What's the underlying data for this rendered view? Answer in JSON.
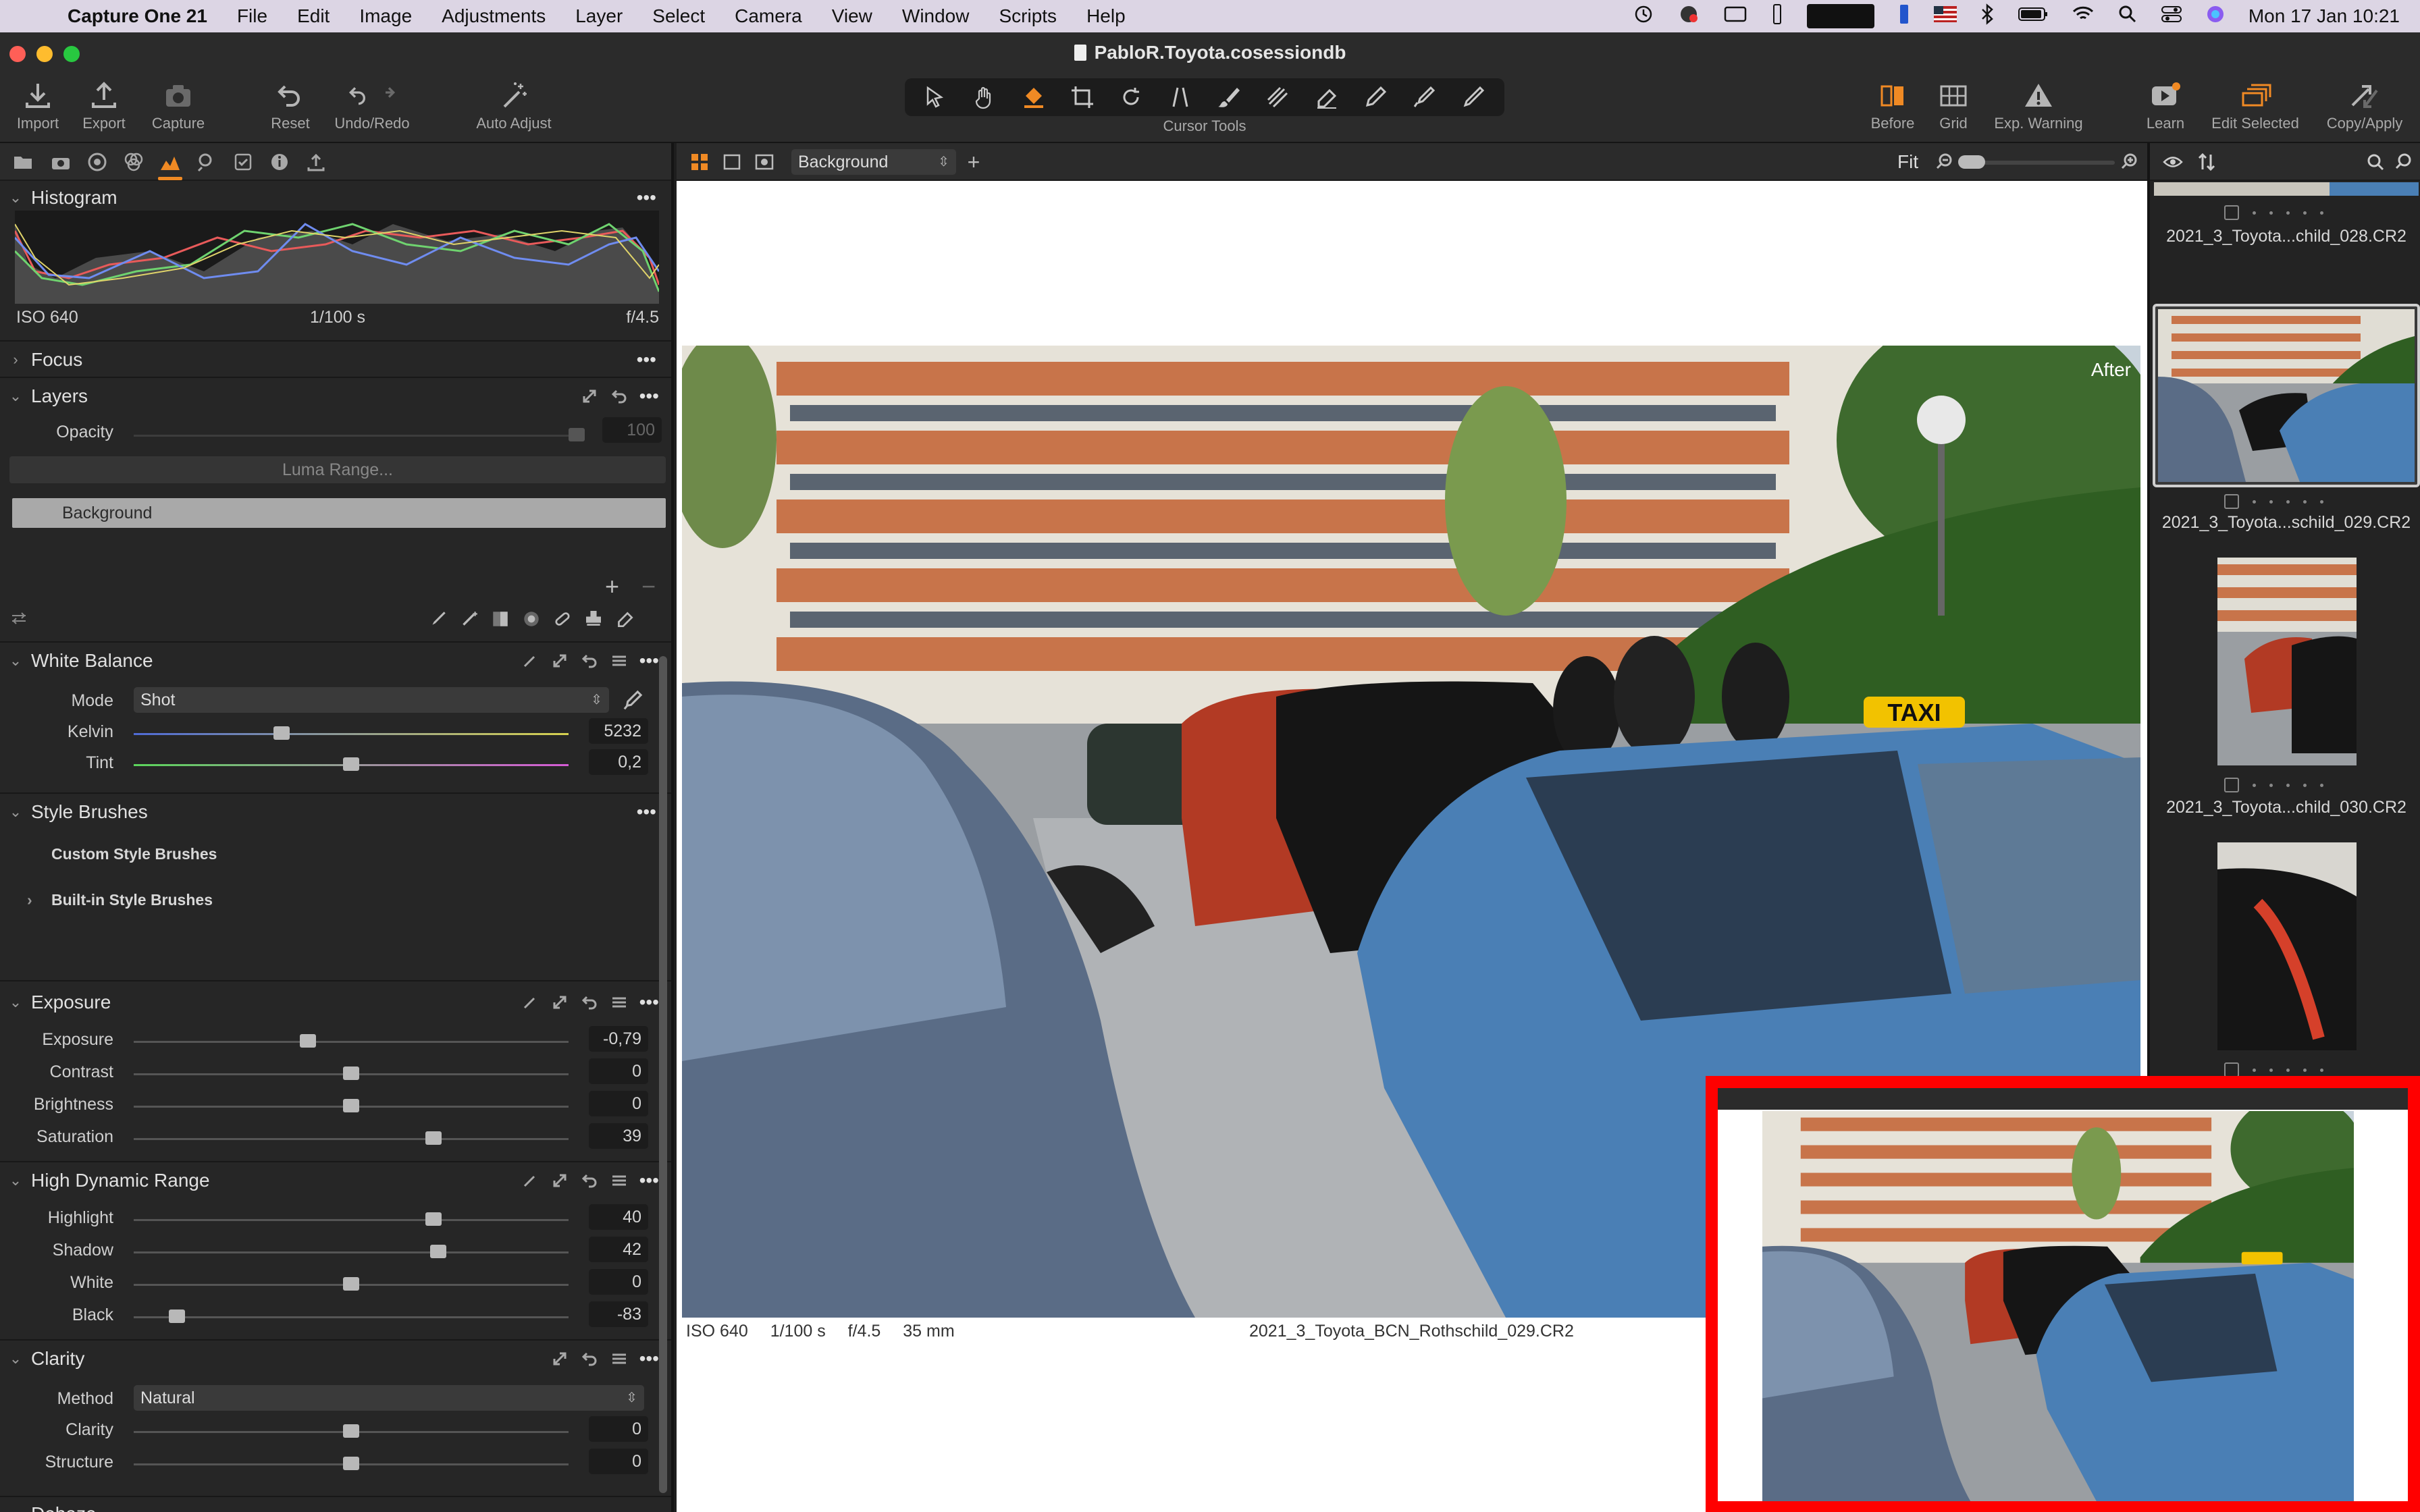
{
  "menubar": {
    "apple_glyph": "",
    "app_name": "Capture One 21",
    "menus": [
      "File",
      "Edit",
      "Image",
      "Adjustments",
      "Layer",
      "Select",
      "Camera",
      "View",
      "Window",
      "Scripts",
      "Help"
    ],
    "clock": "Mon 17 Jan  10:21"
  },
  "window": {
    "title": "PabloR.Toyota.cosessiondb"
  },
  "toolbar": {
    "import": "Import",
    "export": "Export",
    "capture": "Capture",
    "reset": "Reset",
    "undo_redo": "Undo/Redo",
    "auto_adjust": "Auto Adjust",
    "cursor_tools": "Cursor Tools",
    "before": "Before",
    "grid": "Grid",
    "exp_warning": "Exp. Warning",
    "learn": "Learn",
    "edit_selected": "Edit Selected",
    "copy_apply": "Copy/Apply"
  },
  "histogram": {
    "title": "Histogram",
    "iso": "ISO 640",
    "shutter": "1/100 s",
    "aperture": "f/4.5"
  },
  "focus": {
    "title": "Focus"
  },
  "layers": {
    "title": "Layers",
    "opacity_label": "Opacity",
    "opacity_value": "100",
    "luma_range": "Luma Range...",
    "layer_name": "Background"
  },
  "white_balance": {
    "title": "White Balance",
    "mode_label": "Mode",
    "mode_value": "Shot",
    "kelvin_label": "Kelvin",
    "kelvin_value": "5232",
    "kelvin_pos": 0.34,
    "tint_label": "Tint",
    "tint_value": "0,2",
    "tint_pos": 0.5
  },
  "style_brushes": {
    "title": "Style Brushes",
    "custom": "Custom Style Brushes",
    "builtin": "Built-in Style Brushes"
  },
  "exposure": {
    "title": "Exposure",
    "sliders": [
      {
        "label": "Exposure",
        "value": "-0,79",
        "pos": 0.4
      },
      {
        "label": "Contrast",
        "value": "0",
        "pos": 0.5
      },
      {
        "label": "Brightness",
        "value": "0",
        "pos": 0.5
      },
      {
        "label": "Saturation",
        "value": "39",
        "pos": 0.69
      }
    ]
  },
  "hdr": {
    "title": "High Dynamic Range",
    "sliders": [
      {
        "label": "Highlight",
        "value": "40",
        "pos": 0.69
      },
      {
        "label": "Shadow",
        "value": "42",
        "pos": 0.7
      },
      {
        "label": "White",
        "value": "0",
        "pos": 0.5
      },
      {
        "label": "Black",
        "value": "-83",
        "pos": 0.1
      }
    ]
  },
  "clarity": {
    "title": "Clarity",
    "method_label": "Method",
    "method_value": "Natural",
    "sliders": [
      {
        "label": "Clarity",
        "value": "0",
        "pos": 0.5
      },
      {
        "label": "Structure",
        "value": "0",
        "pos": 0.5
      }
    ]
  },
  "dehaze": {
    "title": "Dehaze"
  },
  "viewer": {
    "layer_select": "Background",
    "fit": "Fit",
    "after": "After",
    "iso": "ISO 640",
    "shutter": "1/100 s",
    "aperture": "f/4.5",
    "focal": "35 mm",
    "filename": "2021_3_Toyota_BCN_Rothschild_029.CR2"
  },
  "browser": {
    "items": [
      {
        "name": "2021_3_Toyota...child_028.CR2"
      },
      {
        "name": "2021_3_Toyota...schild_029.CR2"
      },
      {
        "name": "2021_3_Toyota...child_030.CR2"
      }
    ]
  },
  "colors": {
    "accent": "#f08a24",
    "inset_border": "#ff0000",
    "taxi_blue": "#4a7fb5"
  }
}
